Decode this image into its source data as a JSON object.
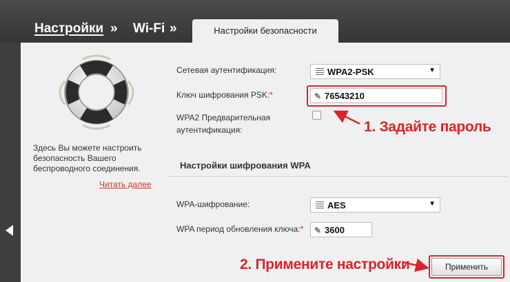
{
  "breadcrumb": {
    "settings": "Настройки",
    "sep1": "»",
    "wifi": "Wi-Fi",
    "sep2": "»"
  },
  "tab": {
    "label": "Настройки безопасности"
  },
  "sidebar": {
    "description": "Здесь Вы можете настроить безопасность Вашего беспроводного соединения.",
    "read_more": "Читать далее"
  },
  "form": {
    "network_auth_label": "Сетевая аутентификация:",
    "network_auth_value": "WPA2-PSK",
    "psk_label": "Ключ шифрования PSK:",
    "psk_value": "76543210",
    "required_mark": "*",
    "wpa2_preauth_label_line1": "WPA2 Предварительная",
    "wpa2_preauth_label_line2": "аутентификация:",
    "wpa2_preauth_checked": false,
    "wpa_section_title": "Настройки шифрования WPA",
    "wpa_encryption_label": "WPA-шифрование:",
    "wpa_encryption_value": "AES",
    "wpa_rekey_label": "WPA период обновления ключа:",
    "wpa_rekey_value": "3600",
    "apply_button": "Применить"
  },
  "annotations": {
    "step1": "1. Задайте пароль",
    "step2": "2. Примените настройки"
  },
  "icons": {
    "lifebuoy": "lifebuoy-icon",
    "list": "list-icon",
    "pencil": "pencil-icon",
    "caret": "caret-down-icon",
    "back": "back-arrow-icon"
  },
  "colors": {
    "header_bg": "#3e3e3e",
    "panel_bg": "#f0f0f0",
    "annotation_red": "#d9242c",
    "link_red": "#c0392b"
  }
}
